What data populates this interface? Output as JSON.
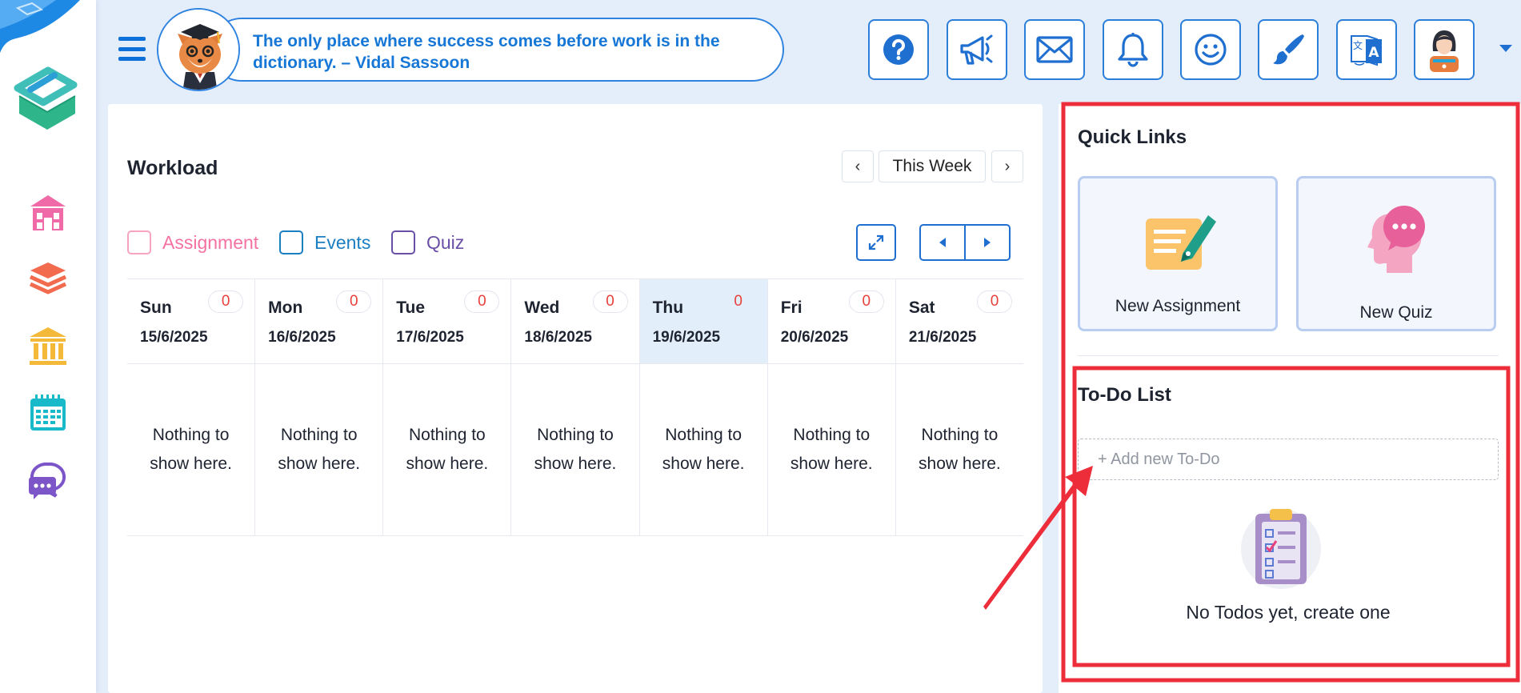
{
  "header": {
    "quote": "The only place where success comes before work is in the dictionary. – Vidal Sassoon",
    "buttons": [
      {
        "name": "help-icon"
      },
      {
        "name": "megaphone-icon"
      },
      {
        "name": "mail-icon"
      },
      {
        "name": "bell-icon"
      },
      {
        "name": "smiley-icon"
      },
      {
        "name": "paintbrush-icon"
      },
      {
        "name": "translate-icon"
      },
      {
        "name": "user-avatar-icon"
      }
    ]
  },
  "sidebar": {
    "items": [
      {
        "icon": "school-icon",
        "color": "#f06aa8"
      },
      {
        "icon": "layers-icon",
        "color": "#f26b4e"
      },
      {
        "icon": "institution-icon",
        "color": "#f5b93a"
      },
      {
        "icon": "calendar-icon",
        "color": "#18b9c9"
      },
      {
        "icon": "chat-icon",
        "color": "#7c55c9"
      }
    ]
  },
  "workload": {
    "title": "Workload",
    "week_label": "This Week",
    "prev_symbol": "‹",
    "next_symbol": "›",
    "legend": [
      {
        "label": "Assignment",
        "color": "#f472a2"
      },
      {
        "label": "Events",
        "color": "#1b7fc2"
      },
      {
        "label": "Quiz",
        "color": "#6a4fa6"
      }
    ],
    "days": [
      {
        "name": "Sun",
        "date": "15/6/2025",
        "count": "0",
        "empty": "Nothing to show here."
      },
      {
        "name": "Mon",
        "date": "16/6/2025",
        "count": "0",
        "empty": "Nothing to show here."
      },
      {
        "name": "Tue",
        "date": "17/6/2025",
        "count": "0",
        "empty": "Nothing to show here."
      },
      {
        "name": "Wed",
        "date": "18/6/2025",
        "count": "0",
        "empty": "Nothing to show here."
      },
      {
        "name": "Thu",
        "date": "19/6/2025",
        "count": "0",
        "empty": "Nothing to show here.",
        "today": true
      },
      {
        "name": "Fri",
        "date": "20/6/2025",
        "count": "0",
        "empty": "Nothing to show here."
      },
      {
        "name": "Sat",
        "date": "21/6/2025",
        "count": "0",
        "empty": "Nothing to show here."
      }
    ]
  },
  "quick_links": {
    "title": "Quick Links",
    "items": [
      {
        "label": "New Assignment",
        "icon": "assignment-pen-icon"
      },
      {
        "label": "New Quiz",
        "icon": "quiz-head-icon"
      }
    ]
  },
  "todo": {
    "title": "To-Do List",
    "placeholder": "+ Add new To-Do",
    "empty_text": "No Todos yet, create one",
    "empty_icon": "clipboard-checklist-icon"
  },
  "colors": {
    "accent": "#1f6fd0",
    "highlight": "#ee2d3b",
    "today_bg": "#e3eefb",
    "count_red": "#e8403b"
  }
}
